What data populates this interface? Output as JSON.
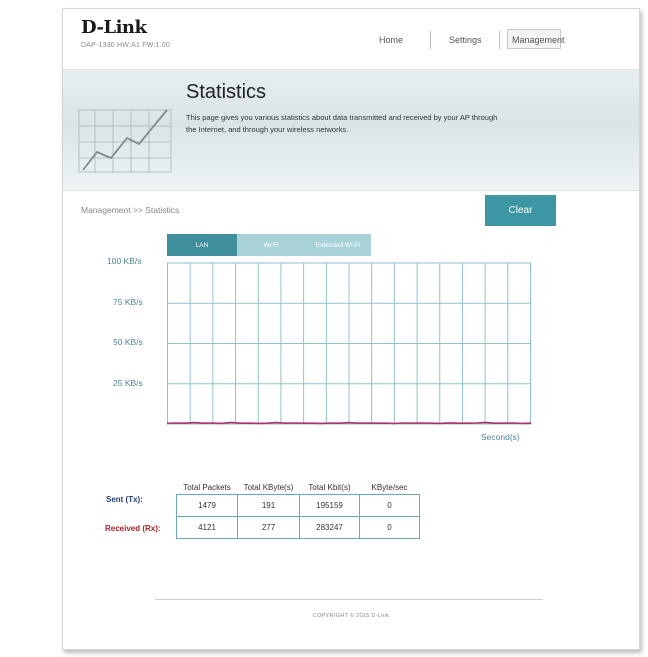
{
  "header": {
    "brand": "D-Link",
    "model_info": "DAP-1330 HW:A1 FW:1.00",
    "nav": [
      "Home",
      "Settings",
      "Management"
    ]
  },
  "banner": {
    "title": "Statistics",
    "description": "This page gives you various statistics about data transmitted and received by your AP through the Internet, and through your wireless networks."
  },
  "breadcrumb": "Management >> Statistics",
  "clear_label": "Clear",
  "tabs": [
    "LAN",
    "Wi-Fi",
    "Extended Wi-Fi"
  ],
  "chart_data": {
    "type": "line",
    "y_ticks": [
      "100 KB/s",
      "75 KB/s",
      "50 KB/s",
      "25 KB/s"
    ],
    "xlabel": "Second(s)",
    "ylim": [
      0,
      100
    ],
    "grid": true,
    "series_color": "#b0306a",
    "values": [
      0.4,
      0.6,
      0.5,
      0.9,
      0.5,
      0.6,
      0.4,
      1.0,
      0.5,
      0.5,
      0.4,
      0.5,
      0.9,
      0.5,
      0.6,
      0.5,
      0.5,
      0.4,
      0.6,
      0.5,
      0.9,
      0.5,
      0.6,
      0.5,
      0.5,
      0.4,
      0.6,
      0.5,
      0.6,
      0.5,
      0.4,
      0.7,
      0.5,
      0.5,
      0.6,
      1.0,
      0.5,
      0.5,
      0.6,
      0.4,
      0.5
    ]
  },
  "stats_table": {
    "headers": [
      "Total Packets",
      "Total KByte(s)",
      "Total Kbit(s)",
      "KByte/sec"
    ],
    "rows": [
      {
        "label": "Sent (Tx):",
        "label_color": "#203f7a",
        "values": [
          "1479",
          "191",
          "195159",
          "0"
        ]
      },
      {
        "label": "Received (Rx):",
        "label_color": "#b31e2a",
        "values": [
          "4121",
          "277",
          "283247",
          "0"
        ]
      }
    ]
  },
  "footer": "COPYRIGHT © 2015 D-Link"
}
